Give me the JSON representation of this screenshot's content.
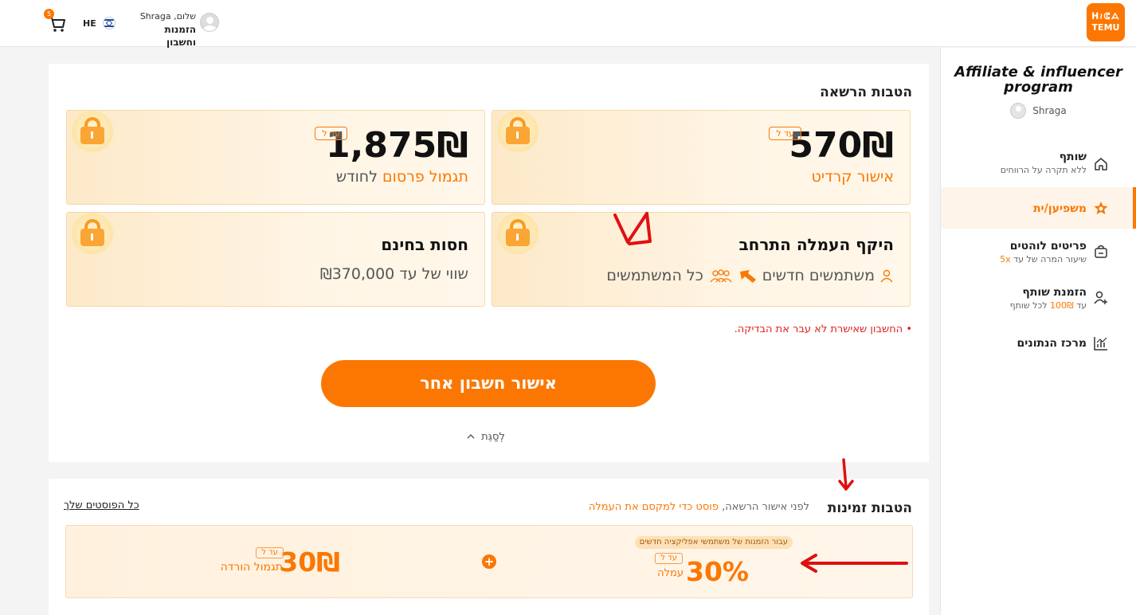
{
  "header": {
    "logo_line1": "ᕼ≀ᕳᗋ",
    "logo_line2": "TEMU",
    "cart_count": "5",
    "lang": "HE",
    "greeting": "שלום, Shraga",
    "orders_account": "הזמנות וחשבון"
  },
  "sidebar": {
    "title": "Affiliate & influencer program",
    "user": "Shraga",
    "items": [
      {
        "label": "שותף",
        "sub": "ללא תקרה על הרווחים"
      },
      {
        "label": "משפיען/ית",
        "sub": ""
      },
      {
        "label": "פריטים לוהטים",
        "sub_prefix": "שיעור המרה של עד ",
        "sub_highlight": "5x"
      },
      {
        "label": "הזמנת שותף",
        "sub_prefix": "עד ",
        "sub_highlight": "100₪",
        "sub_suffix": " לכל שותף"
      },
      {
        "label": "מרכז הנתונים",
        "sub": ""
      }
    ]
  },
  "registration": {
    "title": "הטבות הרשאה",
    "cards": [
      {
        "amount": "570₪",
        "tag": "עד ל",
        "label": "אישור קרדיט"
      },
      {
        "amount": "1,875₪",
        "tag": "עד ל",
        "label_orange": "תגמול פרסום",
        "label_rest": " לחודש"
      },
      {
        "heading": "היקף העמלה התרחב",
        "new_users": "משתמשים חדשים",
        "all_users": "כל המשתמשים"
      },
      {
        "heading": "חסות בחינם",
        "sub": "שווי של עד ₪370,000"
      }
    ],
    "warning": "החשבון שאישרת לא עבר את הבדיקה.",
    "button": "אישור חשבון אחר",
    "collapse": "לְסַגֵּת"
  },
  "temporary": {
    "title": "הטבות זמינות",
    "sub_prefix": "לפני אישור הרשאה, ",
    "sub_orange": "פוסט כדי למקסם את העמלה",
    "link": "כל הפוסטים שלך",
    "pill": "עבור הזמנות של משתמשי אפליקציה חדשים",
    "pct": "30%",
    "pct_tag": "עד ל",
    "pct_label": "עמלה",
    "amount": "30₪",
    "amount_tag": "עד ל",
    "amount_label": "תגמול הורדה"
  },
  "colors": {
    "accent": "#fb7701",
    "warning": "#e02020",
    "annotation": "#e01010"
  }
}
